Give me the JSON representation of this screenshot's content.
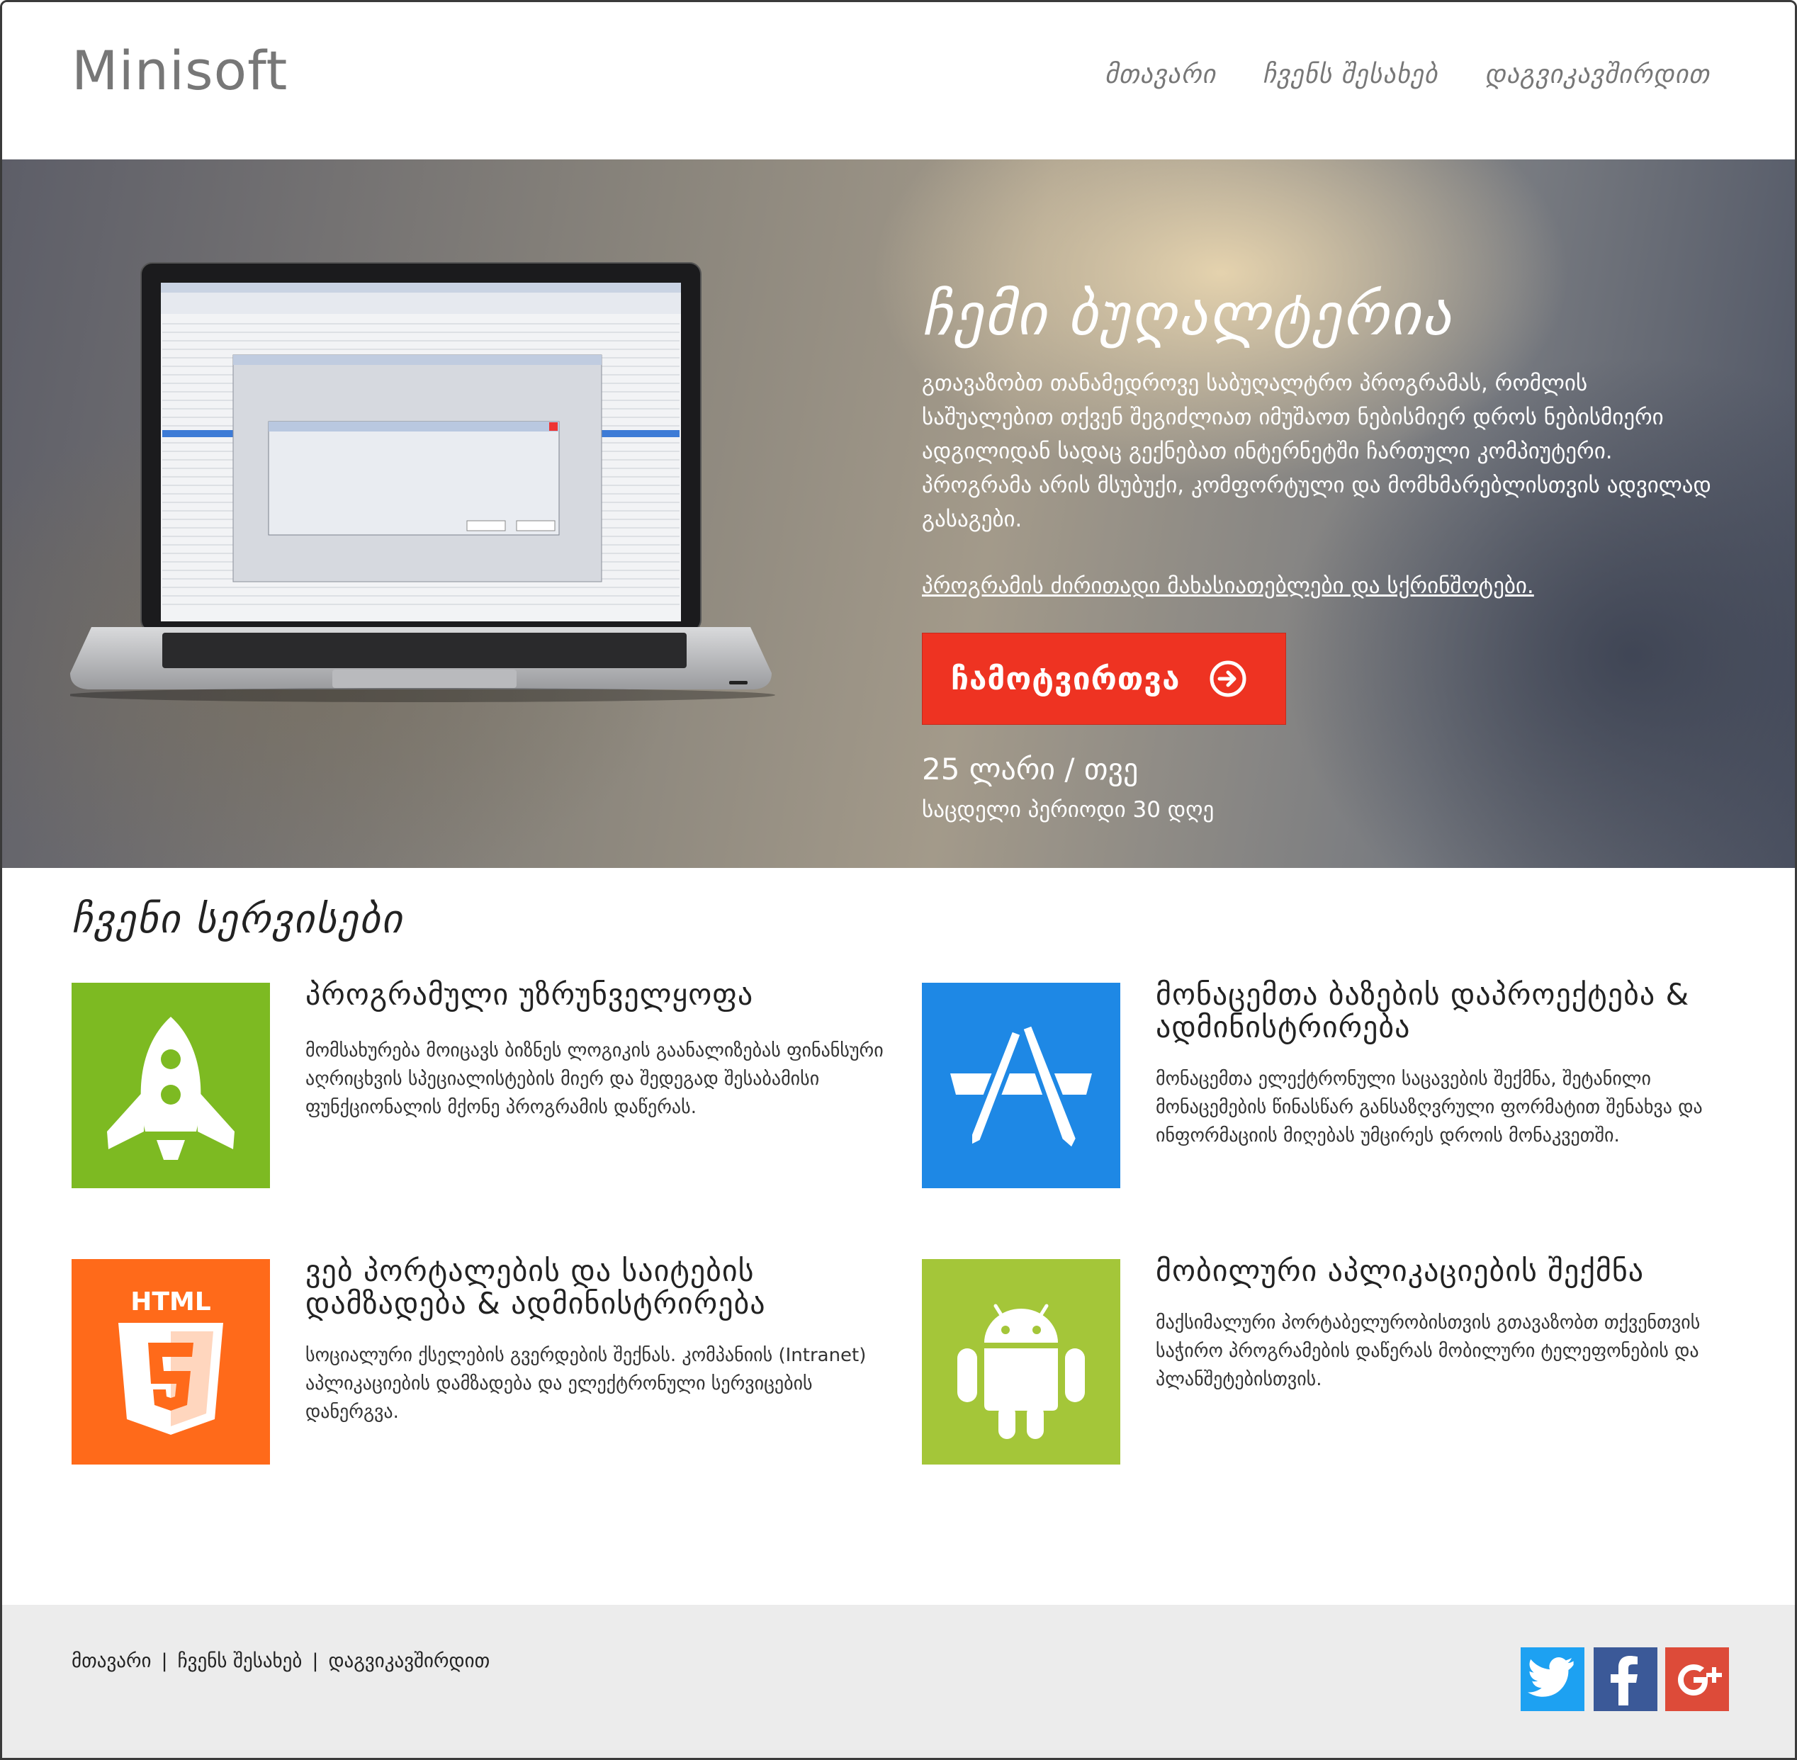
{
  "header": {
    "logo": "Minisoft",
    "nav": [
      "მთავარი",
      "ჩვენს შესახებ",
      "დაგვიკავშირდით"
    ]
  },
  "hero": {
    "title": "ჩემი ბუღალტერია",
    "description": "გთავაზობთ თანამედროვე საბუღალტრო პროგრამას, რომლის საშუალებით თქვენ შეგიძლიათ იმუშაოთ ნებისმიერ დროს ნებისმიერი ადგილიდან სადაც გექნებათ ინტერნეტში ჩართული კომპიუტერი. პროგრამა არის მსუბუქი, კომფორტული და მომხმარებლისთვის ადვილად გასაგები.",
    "features_link": "პროგრამის ძირითადი მახასიათებლები და სქრინშოტები.",
    "download_label": "ჩამოტვირთვა",
    "price": "25 ლარი / თვე",
    "trial": "საცდელი პერიოდი 30 დღე"
  },
  "services": {
    "title": "ჩვენი სერვისები",
    "items": [
      {
        "title": "პროგრამული უზრუნველყოფა",
        "text": "მომსახურება მოიცავს ბიზნეს ლოგიკის გაანალიზებას ფინანსური აღრიცხვის სპეციალისტების მიერ და შედეგად შესაბამისი ფუნქციონალის მქონე პროგრამის დაწერას.",
        "icon": "rocket-icon",
        "color": "#7dba22"
      },
      {
        "title": "მონაცემთა ბაზების დაპროექტება & ადმინისტრირება",
        "text": "მონაცემთა ელექტრონული საცავების შექმნა, შეტანილი მონაცემების წინასწარ განსაზღვრული ფორმატით შენახვა და ინფორმაციის მიღებას უმცირეს დროის მონაკვეთში.",
        "icon": "app-store-icon",
        "color": "#1e88e5"
      },
      {
        "title": "ვებ პორტალების და საიტების დამზადება & ადმინისტრირება",
        "text": "სოციალური ქსელების გვერდების შექნას. კომპანიის (Intranet) აპლიკაციების დამზადება და ელექტრონული სერვიცების დანერგვა.",
        "icon": "html5-icon",
        "color": "#ff6a1a",
        "html5_text": "HTML"
      },
      {
        "title": "მობილური აპლიკაციების შექმნა",
        "text": "მაქსიმალური პორტაბელურობისთვის გთავაზობთ თქვენთვის საჭირო პროგრამების დაწერას მობილური ტელეფონების და პლანშეტებისთვის.",
        "icon": "android-icon",
        "color": "#a4c639"
      }
    ]
  },
  "footer": {
    "links": [
      "მთავარი",
      "ჩვენს შესახებ",
      "დაგვიკავშირდით"
    ],
    "separator": "|",
    "social": [
      {
        "name": "twitter-icon",
        "color": "#1da1f2"
      },
      {
        "name": "facebook-icon",
        "color": "#3b5998"
      },
      {
        "name": "google-plus-icon",
        "color": "#dd4b39"
      }
    ]
  }
}
